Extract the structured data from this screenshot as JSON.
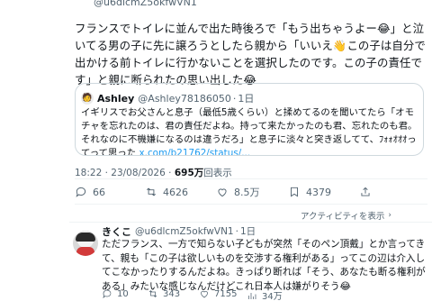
{
  "top_partial_handle": "@u6dlcmZ5okfwVN1",
  "post": {
    "text": "フランスでトイレに並んで出た時後ろで「もう出ちゃうよー😂」と泣いてる男の子に先に譲ろうとしたら親から「いいえ👋この子は自分で出かける前トイレに行かないことを選択したのです。この子の責任です」と親に断られたの思い出した😂"
  },
  "quote": {
    "name": "Ashley",
    "handle": "@Ashley78186050",
    "separator": "·",
    "time": "1日",
    "avatar_emoji": "🧑",
    "text": "イギリスでお父さんと息子（最低5歳くらい）と揉めてるのを聞いてたら「オモチャを忘れたのは、君の責任だよね。持って来たかったのも君、忘れたのも君。それなのに不機嫌になるのは違うだろ」と息子に淡々と突き返してて、ﾌｫｫｵｵｵってって思った",
    "link": "x.com/b21762/status/..."
  },
  "meta": {
    "time": "18:22 · 23/08/2026",
    "sep": "·",
    "views": "695万",
    "views_label": "回表示"
  },
  "actions": {
    "replies": "66",
    "reposts": "4626",
    "likes": "8.5万",
    "bookmarks": "4379"
  },
  "activity_label": "アクティビティを表示",
  "reply": {
    "name": "きくこ",
    "handle": "@u6dlcmZ5okfwVN1",
    "separator": "·",
    "time": "1日",
    "text": "ただフランス、一方で知らない子どもが突然「そのペン頂戴」とか言ってきて、親も「この子は欲しいものを交渉する権利がある」ってこの辺は介入してこなかったりするんだよね。きっぱり断れば「そう、あなたも断る権利がある」みたいな感じなんだけどこれ日本人は嫌がりそう😂",
    "actions": {
      "replies": "10",
      "reposts": "343",
      "likes": "7155",
      "views": "34万"
    }
  },
  "colors": {
    "text": "#0f1419",
    "secondary": "#536471",
    "link": "#1d9bf0",
    "border": "#cfd9de"
  }
}
